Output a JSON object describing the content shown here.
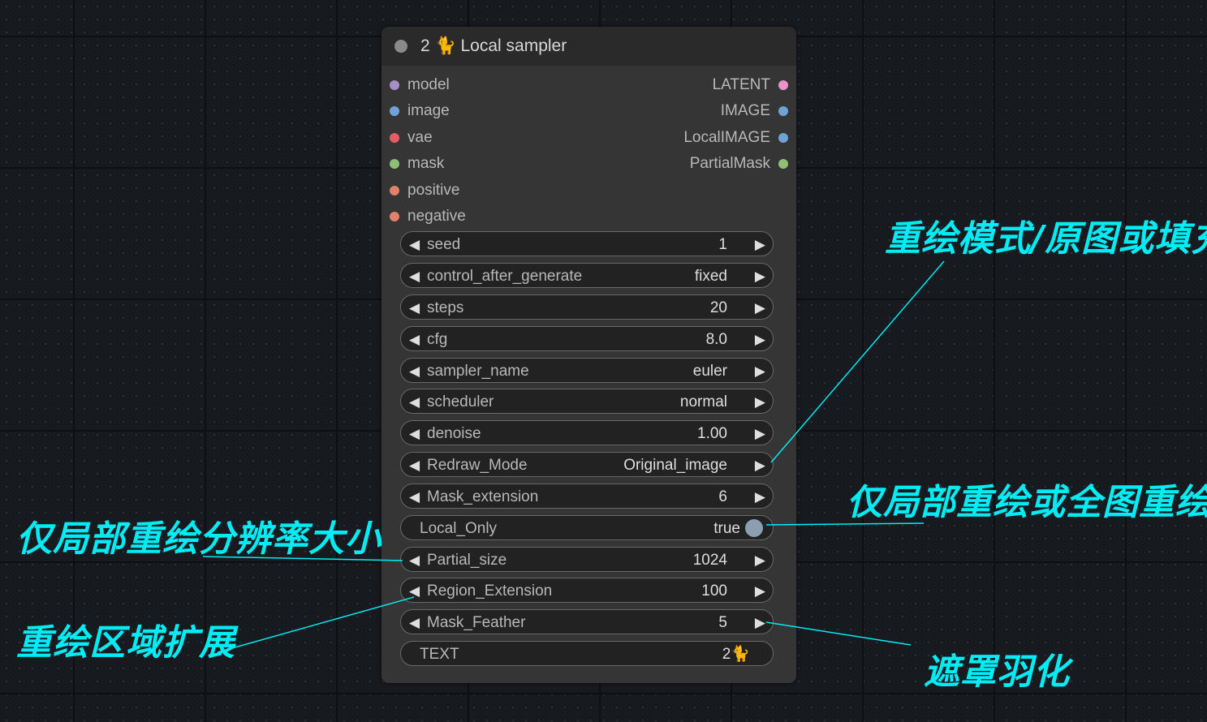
{
  "node": {
    "title": "2 🐈 Local sampler",
    "inputs": [
      {
        "label": "model",
        "color": "#a58fc4"
      },
      {
        "label": "image",
        "color": "#6fa3d8"
      },
      {
        "label": "vae",
        "color": "#e55c66"
      },
      {
        "label": "mask",
        "color": "#8fbf77"
      },
      {
        "label": "positive",
        "color": "#e0816a"
      },
      {
        "label": "negative",
        "color": "#e0816a"
      }
    ],
    "outputs": [
      {
        "label": "LATENT",
        "color": "#e994c8"
      },
      {
        "label": "IMAGE",
        "color": "#6fa3d8"
      },
      {
        "label": "LocalIMAGE",
        "color": "#6fa3d8"
      },
      {
        "label": "PartialMask",
        "color": "#8fbf77"
      }
    ],
    "widgets": {
      "seed": {
        "label": "seed",
        "value": "1"
      },
      "control_after_generate": {
        "label": "control_after_generate",
        "value": "fixed"
      },
      "steps": {
        "label": "steps",
        "value": "20"
      },
      "cfg": {
        "label": "cfg",
        "value": "8.0"
      },
      "sampler_name": {
        "label": "sampler_name",
        "value": "euler"
      },
      "scheduler": {
        "label": "scheduler",
        "value": "normal"
      },
      "denoise": {
        "label": "denoise",
        "value": "1.00"
      },
      "redraw_mode": {
        "label": "Redraw_Mode",
        "value": "Original_image"
      },
      "mask_extension": {
        "label": "Mask_extension",
        "value": "6"
      },
      "local_only": {
        "label": "Local_Only",
        "value": "true"
      },
      "partial_size": {
        "label": "Partial_size",
        "value": "1024"
      },
      "region_extension": {
        "label": "Region_Extension",
        "value": "100"
      },
      "mask_feather": {
        "label": "Mask_Feather",
        "value": "5"
      },
      "text": {
        "label": "TEXT",
        "value": "2🐈"
      }
    },
    "arrows": {
      "left": "◀",
      "right": "▶"
    }
  },
  "annotations": {
    "redraw_mode": "重绘模式/原图或填充",
    "local_only": "仅局部重绘或全图重绘",
    "partial_size": "仅局部重绘分辨率大小",
    "region_extension": "重绘区域扩展",
    "mask_feather": "遮罩羽化"
  },
  "annotation_color": "#00ecf5"
}
